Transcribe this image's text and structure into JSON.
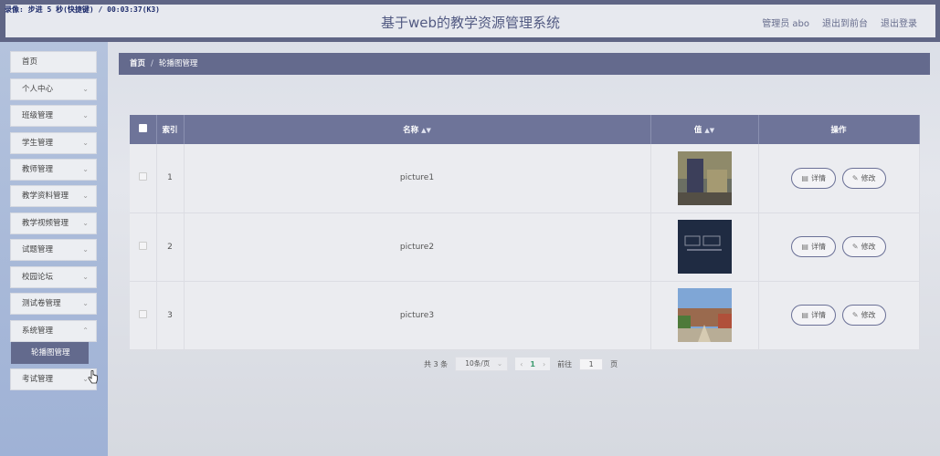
{
  "recording_label": "录像: 步进 5 秒(快捷键) / 00:03:37(K3)",
  "header": {
    "title": "基于web的教学资源管理系统",
    "links": [
      "管理员 abo",
      "退出到前台",
      "退出登录"
    ]
  },
  "sidebar": {
    "items": [
      {
        "label": "首页",
        "has_chevron": false
      },
      {
        "label": "个人中心",
        "has_chevron": true
      },
      {
        "label": "班级管理",
        "has_chevron": true
      },
      {
        "label": "学生管理",
        "has_chevron": true
      },
      {
        "label": "教师管理",
        "has_chevron": true
      },
      {
        "label": "教学资料管理",
        "has_chevron": true
      },
      {
        "label": "教学视频管理",
        "has_chevron": true
      },
      {
        "label": "试题管理",
        "has_chevron": true
      },
      {
        "label": "校园论坛",
        "has_chevron": true
      },
      {
        "label": "测试卷管理",
        "has_chevron": true
      },
      {
        "label": "系统管理",
        "has_chevron": true
      },
      {
        "label": "考试管理",
        "has_chevron": true
      }
    ],
    "active_submenu": "轮播图管理"
  },
  "breadcrumb": {
    "home": "首页",
    "sep": "/",
    "current": "轮播图管理"
  },
  "table": {
    "columns": [
      "",
      "索引",
      "名称",
      "值",
      "操作"
    ],
    "rows": [
      {
        "index": "1",
        "name": "picture1",
        "thumb": "thumb-1"
      },
      {
        "index": "2",
        "name": "picture2",
        "thumb": "thumb-2"
      },
      {
        "index": "3",
        "name": "picture3",
        "thumb": "thumb-3"
      }
    ],
    "detail_label": "详情",
    "edit_label": "修改"
  },
  "pagination": {
    "total_text": "共 3 条",
    "page_size": "10条/页",
    "current_page": "1",
    "goto_label": "前往",
    "goto_value": "1",
    "page_unit": "页"
  },
  "icons": {
    "sort": "sort-icon",
    "chevron": "chevron-down-icon",
    "detail": "document-icon",
    "edit": "pencil-icon"
  },
  "colors": {
    "accent": "#646a8d",
    "table_header": "#6e7499",
    "sidebar": "#a7b8d8"
  }
}
